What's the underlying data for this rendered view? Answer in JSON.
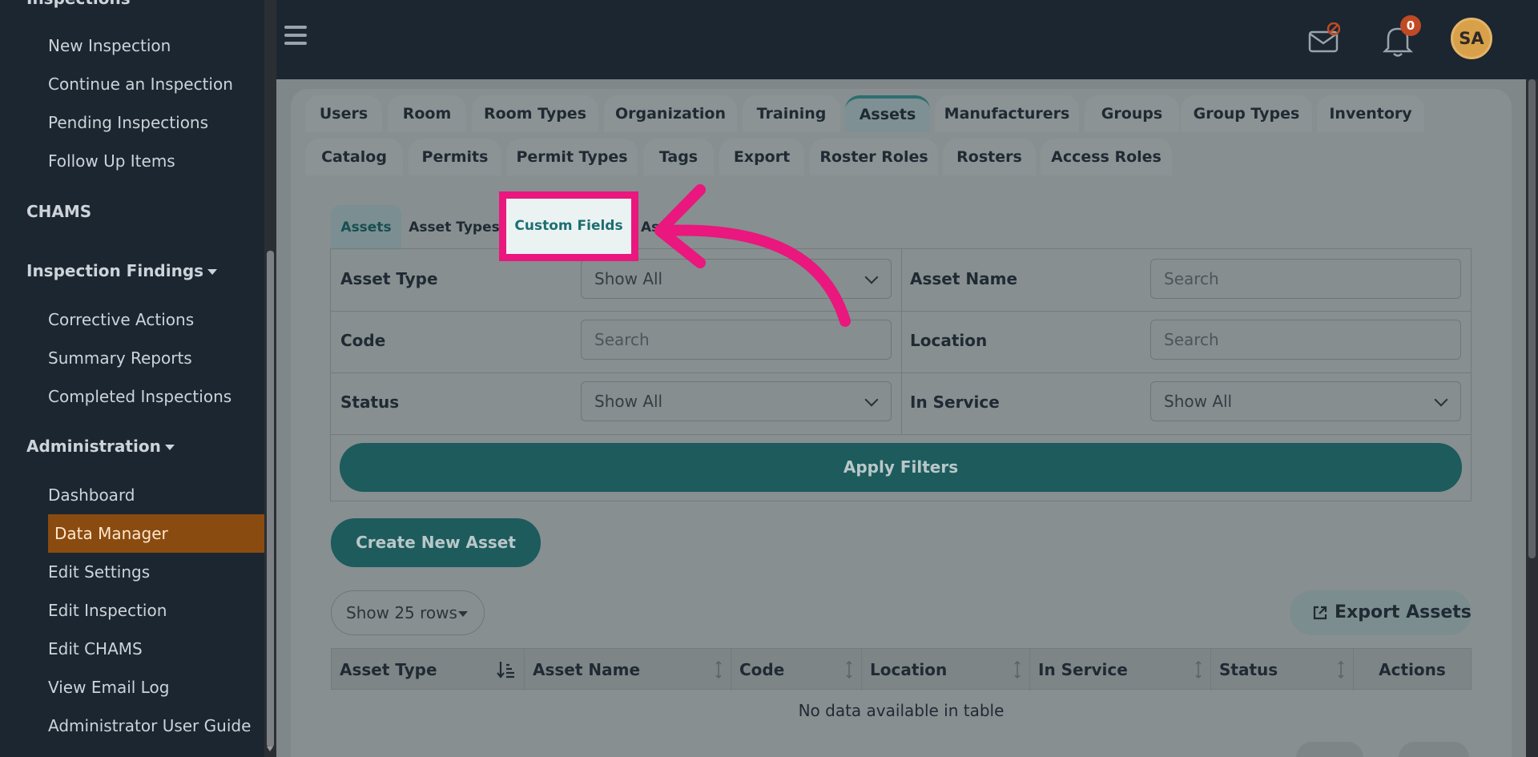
{
  "sidebar": {
    "cut_heading": "Inspections",
    "inspections_items": [
      "New Inspection",
      "Continue an Inspection",
      "Pending Inspections",
      "Follow Up Items"
    ],
    "chams": "CHAMS",
    "findings_heading": "Inspection Findings",
    "findings_items": [
      "Corrective Actions",
      "Summary Reports",
      "Completed Inspections"
    ],
    "admin_heading": "Administration",
    "admin_items": [
      "Dashboard",
      "Data Manager",
      "Edit Settings",
      "Edit Inspection",
      "Edit CHAMS",
      "View Email Log",
      "Administrator User Guide"
    ]
  },
  "topbar": {
    "notification_count": "0",
    "avatar_initials": "SA"
  },
  "tabs_row1": [
    "Users",
    "Room",
    "Room Types",
    "Organization",
    "Training",
    "Assets",
    "Manufacturers",
    "Groups",
    "Group Types",
    "Inventory"
  ],
  "tabs_row2": [
    "Catalog",
    "Permits",
    "Permit Types",
    "Tags",
    "Export",
    "Roster Roles",
    "Rosters",
    "Access Roles"
  ],
  "active_tab": "Assets",
  "subtabs": [
    "Assets",
    "Asset Types",
    "Custom Fields",
    "As"
  ],
  "filters": {
    "asset_type_label": "Asset Type",
    "asset_type_value": "Show All",
    "asset_name_label": "Asset Name",
    "asset_name_placeholder": "Search",
    "code_label": "Code",
    "code_placeholder": "Search",
    "location_label": "Location",
    "location_placeholder": "Search",
    "status_label": "Status",
    "status_value": "Show All",
    "in_service_label": "In Service",
    "in_service_value": "Show All",
    "apply_label": "Apply Filters"
  },
  "create_label": "Create New Asset",
  "rows_label": "Show 25 rows",
  "export_label": "Export Assets",
  "table": {
    "headers": [
      "Asset Type",
      "Asset Name",
      "Code",
      "Location",
      "In Service",
      "Status",
      "Actions"
    ],
    "empty": "No data available in table"
  },
  "colors": {
    "highlight": "#e9177e",
    "teal": "#1d5b5d",
    "active_sidebar": "#8a4b10"
  }
}
